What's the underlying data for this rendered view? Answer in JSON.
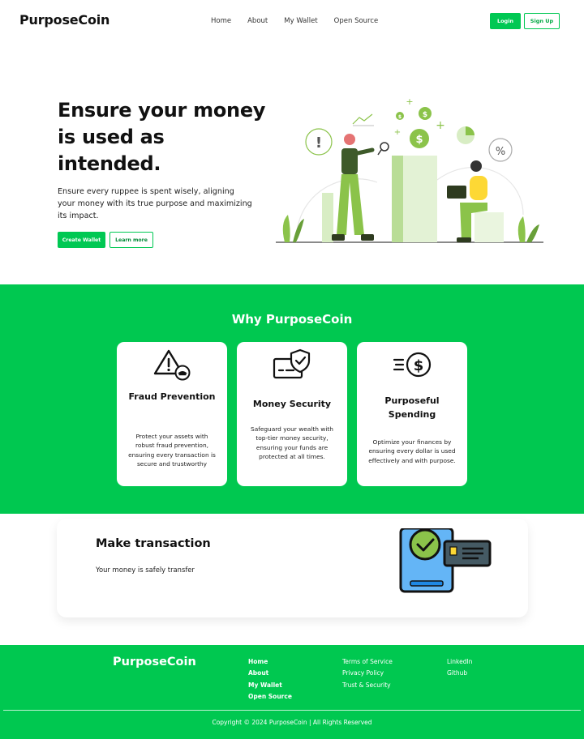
{
  "nav": {
    "brand": "PurposeCoin",
    "links": [
      "Home",
      "About",
      "My Wallet",
      "Open Source"
    ],
    "login": "Login",
    "signup": "Sign Up"
  },
  "hero": {
    "title": "Ensure your money is used as intended.",
    "description": "Ensure every ruppee is spent wisely, aligning your money with its true purpose and maximizing its impact.",
    "create_button": "Create Wallet",
    "learn_button": "Learn more"
  },
  "why": {
    "title": "Why PurposeCoin",
    "cards": [
      {
        "title": "Fraud Prevention",
        "icon": "fraud-alert-icon",
        "description": "Protect your assets with robust fraud prevention, ensuring every transaction is secure and trustworthy"
      },
      {
        "title": "Money Security",
        "icon": "shield-check-icon",
        "description": "Safeguard your wealth with top-tier money security, ensuring your funds are protected at all times."
      },
      {
        "title": "Purposeful Spending",
        "icon": "fast-dollar-icon",
        "description": "Optimize your finances by ensuring every dollar is used effectively and with purpose."
      }
    ]
  },
  "transaction": {
    "title": "Make transaction",
    "subtitle": "Your money is safely transfer"
  },
  "footer": {
    "brand": "PurposeCoin",
    "nav_links": [
      "Home",
      "About",
      "My Wallet",
      "Open Source"
    ],
    "legal_links": [
      "Terms of Service",
      "Privacy Policy",
      "Trust & Security"
    ],
    "social_links": [
      "LinkedIn",
      "Github"
    ],
    "copyright": "Copyright © 2024 PurposeCoin | All Rights Reserved"
  },
  "colors": {
    "accent": "#00c853",
    "section_bg": "#00c850",
    "illustration_green": "#8bc34a",
    "illustration_yellow": "#fdd835"
  }
}
